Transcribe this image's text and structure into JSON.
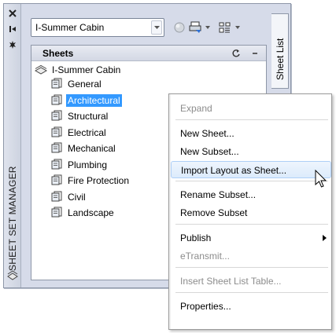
{
  "palette": {
    "title": "SHEET SET MANAGER",
    "side_tab": "Sheet List"
  },
  "toolbar": {
    "sheet_set_selected": "I-Summer Cabin"
  },
  "tree": {
    "header_label": "Sheets",
    "root": "I-Summer Cabin",
    "items": [
      {
        "label": "General",
        "selected": false
      },
      {
        "label": "Architectural",
        "selected": true
      },
      {
        "label": "Structural",
        "selected": false
      },
      {
        "label": "Electrical",
        "selected": false
      },
      {
        "label": "Mechanical",
        "selected": false
      },
      {
        "label": "Plumbing",
        "selected": false
      },
      {
        "label": "Fire Protection",
        "selected": false
      },
      {
        "label": "Civil",
        "selected": false
      },
      {
        "label": "Landscape",
        "selected": false
      }
    ]
  },
  "context_menu": {
    "items": [
      {
        "label": "Expand",
        "enabled": false
      },
      {
        "label": "New Sheet...",
        "enabled": true
      },
      {
        "label": "New Subset...",
        "enabled": true
      },
      {
        "label": "Import Layout as Sheet...",
        "enabled": true,
        "hovered": true
      },
      {
        "label": "Rename Subset...",
        "enabled": true
      },
      {
        "label": "Remove Subset",
        "enabled": true
      },
      {
        "label": "Publish",
        "enabled": true,
        "has_submenu": true
      },
      {
        "label": "eTransmit...",
        "enabled": false
      },
      {
        "label": "Insert Sheet List Table...",
        "enabled": false
      },
      {
        "label": "Properties...",
        "enabled": true
      }
    ]
  },
  "colors": {
    "selection": "#3399ff",
    "palette_bg": "#d6dbe9",
    "menu_hover": "#dcebfc"
  }
}
